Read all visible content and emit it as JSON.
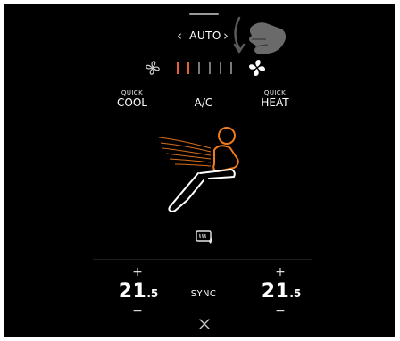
{
  "climate": {
    "mode": {
      "label": "AUTO",
      "prev_icon": "chevron-left-icon",
      "next_icon": "chevron-right-icon"
    },
    "gesture_hint_icon": "swipe-down-hand-icon",
    "fan": {
      "level": 2,
      "max_level": 6,
      "active_color": "#e8603a",
      "inactive_color": "#7a7a7a",
      "min_icon": "fan-low-icon",
      "max_icon": "fan-high-icon"
    },
    "quick_cool": {
      "small": "QUICK",
      "big": "COOL"
    },
    "ac": {
      "label": "A/C"
    },
    "quick_heat": {
      "small": "QUICK",
      "big": "HEAT"
    },
    "seat_icon": "seat-airflow-icon",
    "airflow_color": "#f07a1c",
    "rear_defrost_icon": "rear-window-defrost-icon",
    "left_temp": {
      "integer": "21",
      "decimal": ".5",
      "plus": "+",
      "minus": "−"
    },
    "sync": {
      "label": "SYNC"
    },
    "right_temp": {
      "integer": "21",
      "decimal": ".5",
      "plus": "+",
      "minus": "−"
    },
    "close_icon": "close-icon"
  }
}
